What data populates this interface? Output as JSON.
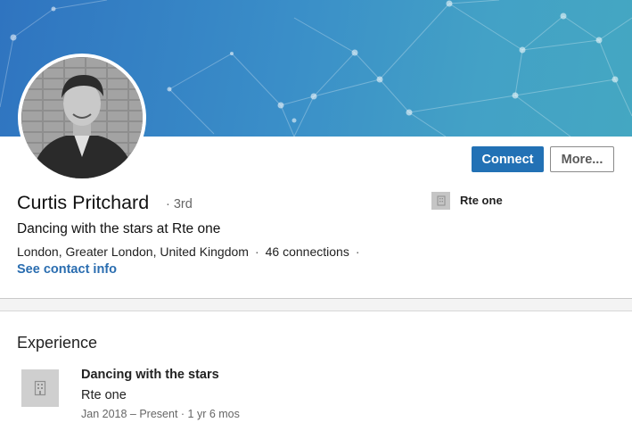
{
  "profile": {
    "name": "Curtis Pritchard",
    "degree": "· 3rd",
    "headline": "Dancing with the stars at Rte one",
    "location": "London, Greater London, United Kingdom",
    "connections": "46 connections",
    "separator": "·",
    "contact_link": "See contact info"
  },
  "actions": {
    "connect_label": "Connect",
    "more_label": "More..."
  },
  "current_company": {
    "name": "Rte one",
    "icon": "building-icon"
  },
  "experience": {
    "title": "Experience",
    "items": [
      {
        "role": "Dancing with the stars",
        "company": "Rte one",
        "dates": "Jan 2018 – Present · 1 yr 6 mos",
        "icon": "building-icon"
      }
    ]
  },
  "colors": {
    "accent": "#2271b5",
    "link": "#2a6db0",
    "banner_start": "#2f74c0",
    "banner_end": "#44a7c2"
  }
}
